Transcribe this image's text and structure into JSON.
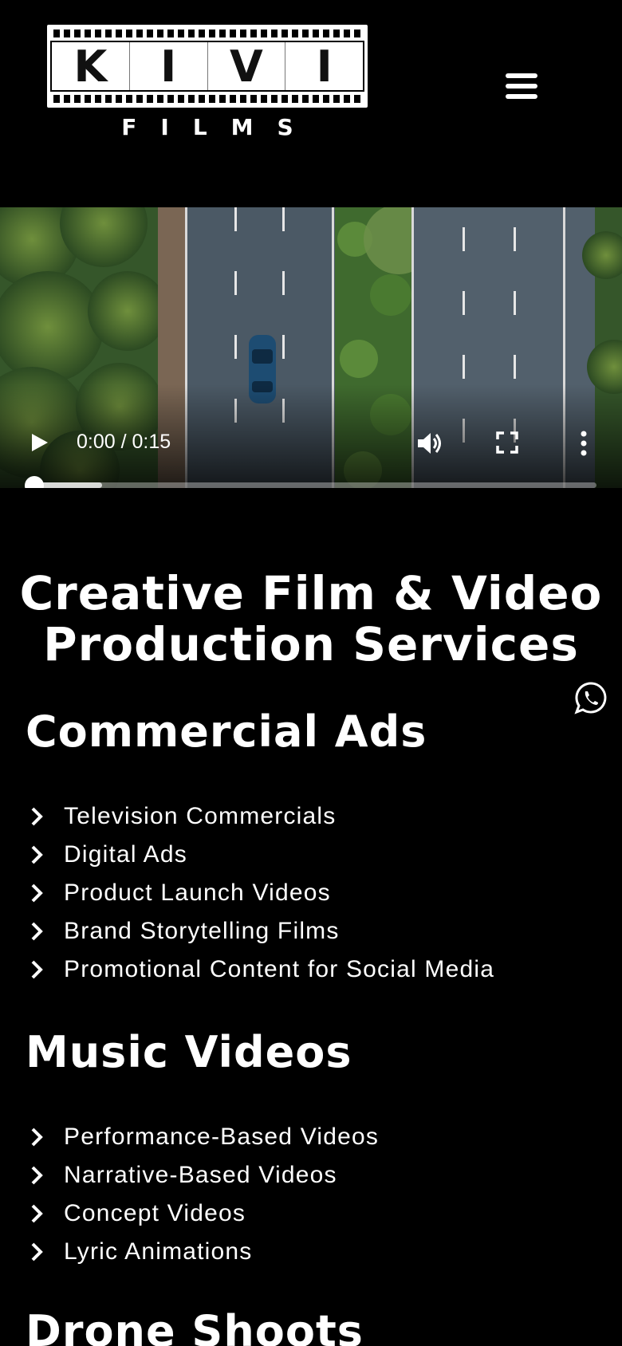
{
  "header": {
    "logo_frames": [
      "K",
      "I",
      "V",
      "I"
    ],
    "logo_subtitle": "FILMS",
    "menu_icon": "hamburger-menu-icon"
  },
  "video": {
    "time": "0:00 / 0:15",
    "progress_played_fraction": 0,
    "progress_buffered_fraction": 0.12,
    "icons": [
      "play-icon",
      "volume-icon",
      "fullscreen-icon",
      "more-vert-icon"
    ]
  },
  "main": {
    "heading_line1": "Creative Film & Video",
    "heading_line2": "Production Services",
    "sections": [
      {
        "title": "Commercial Ads",
        "items": [
          "Television Commercials",
          "Digital Ads",
          "Product Launch Videos",
          "Brand Storytelling Films",
          "Promotional Content for Social Media"
        ]
      },
      {
        "title": "Music Videos",
        "items": [
          "Performance-Based Videos",
          "Narrative-Based Videos",
          "Concept Videos",
          "Lyric Animations"
        ]
      },
      {
        "title": "Drone Shoots",
        "items": []
      }
    ]
  },
  "floating": {
    "whatsapp_icon": "whatsapp-icon"
  },
  "colors": {
    "background": "#000000",
    "text": "#ffffff"
  }
}
